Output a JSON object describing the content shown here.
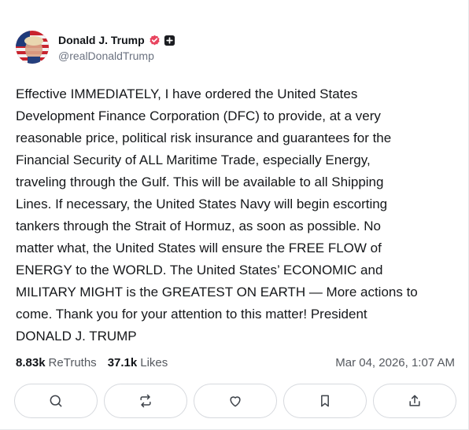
{
  "author": {
    "display_name": "Donald J. Trump",
    "handle": "@realDonaldTrump",
    "avatar": "flag-portrait-avatar",
    "badges": [
      "verified-badge-icon",
      "plus-badge-icon"
    ],
    "verified_color": "#e8455f"
  },
  "post": {
    "text": "Effective IMMEDIATELY, I have ordered the United States\nDevelopment Finance Corporation (DFC) to provide, at a very\nreasonable price, political risk insurance and guarantees for the\nFinancial Security of ALL Maritime Trade, especially Energy,\ntraveling through the Gulf. This will be available to all Shipping\nLines. If necessary, the United States Navy will begin escorting\ntankers through the Strait of Hormuz, as soon as possible. No\nmatter what, the United States will ensure the FREE FLOW of\nENERGY to the WORLD. The United States’ ECONOMIC and\nMILITARY MIGHT is the GREATEST ON EARTH — More actions to\ncome. Thank you for your attention to this matter! President\nDONALD J. TRUMP"
  },
  "stats": {
    "retruths_count": "8.83k",
    "retruths_label": "ReTruths",
    "likes_count": "37.1k",
    "likes_label": "Likes",
    "timestamp": "Mar 04, 2026, 1:07 AM"
  },
  "actions": [
    {
      "icon": "reply-icon"
    },
    {
      "icon": "retruth-icon"
    },
    {
      "icon": "like-icon"
    },
    {
      "icon": "bookmark-icon"
    },
    {
      "icon": "share-icon"
    }
  ]
}
